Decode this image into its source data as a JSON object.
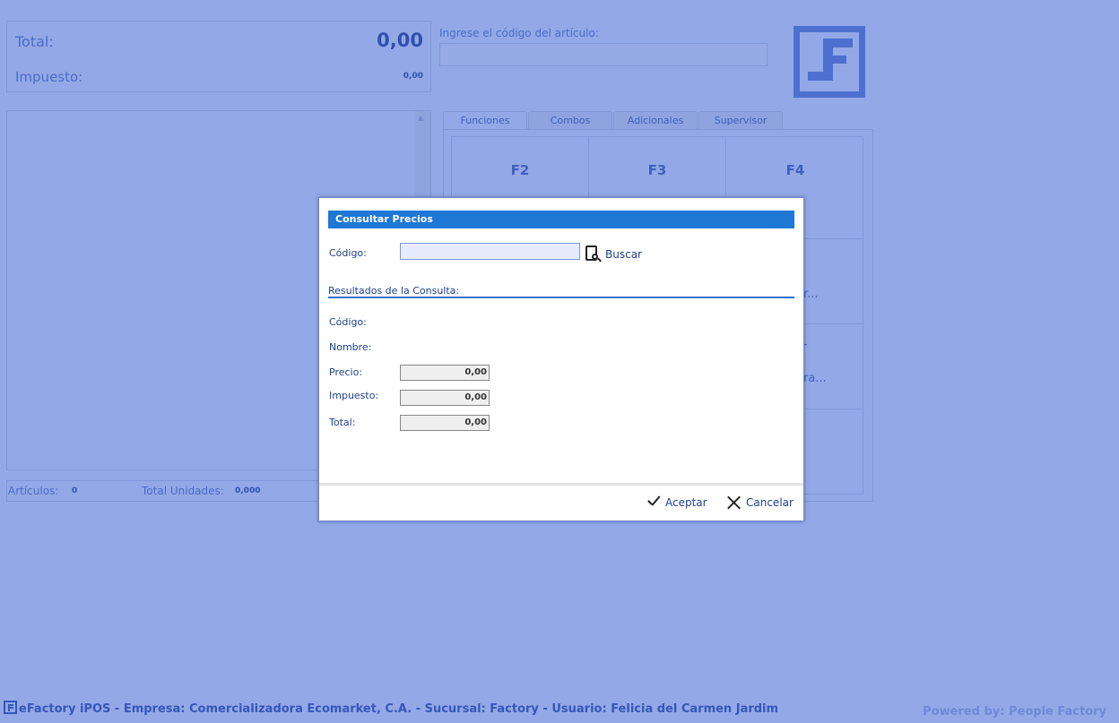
{
  "totals": {
    "total_label": "Total:",
    "total_value": "0,00",
    "tax_label": "Impuesto:",
    "tax_value": "0,00"
  },
  "article_code": {
    "label": "Ingrese el código del artículo:",
    "value": ""
  },
  "stats": {
    "articles_label": "Artículos:",
    "articles_value": "0",
    "units_label": "Total Unidades:",
    "units_value": "0,000"
  },
  "tabs": [
    {
      "label": "Funciones",
      "active": true
    },
    {
      "label": "Combos",
      "active": false
    },
    {
      "label": "Adicionales",
      "active": false
    },
    {
      "label": "Supervisor",
      "active": false
    }
  ],
  "function_keys": [
    "F2",
    "F3",
    "F4"
  ],
  "partial_hints": [
    "r...",
    "-",
    "ra..."
  ],
  "status_bar": "eFactory iPOS - Empresa: Comercializadora Ecomarket, C.A. - Sucursal: Factory - Usuario: Felicia del Carmen Jardim",
  "powered_by": "Powered by: People Factory",
  "modal": {
    "title": "Consultar Precios",
    "code_label": "Código:",
    "code_value": "",
    "search_label": "Buscar",
    "results_title": "Resultados de la Consulta:",
    "result_code_label": "Código:",
    "result_name_label": "Nombre:",
    "price_label": "Precio:",
    "price_value": "0,00",
    "tax_label": "Impuesto:",
    "tax_value": "0,00",
    "total_label": "Total:",
    "total_value": "0,00",
    "accept_label": "Aceptar",
    "cancel_label": "Cancelar"
  },
  "colors": {
    "background": "#93a8e6",
    "modal_header": "#1f77d6",
    "accent": "#3557b8"
  }
}
